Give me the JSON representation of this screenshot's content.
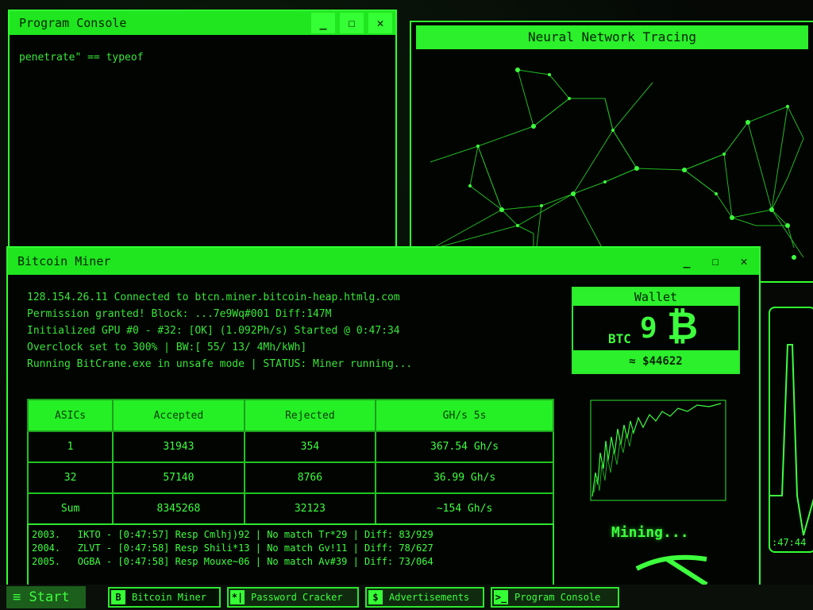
{
  "program_console": {
    "title": "Program Console",
    "text": "penetrate\" == typeof",
    "min": "_",
    "max": "☐",
    "close": "✕"
  },
  "neural": {
    "title": "Neural Network Tracing"
  },
  "miner": {
    "title": "Bitcoin Miner",
    "min": "_",
    "max": "☐",
    "close": "✕",
    "lines": [
      "128.154.26.11 Connected to btcn.miner.bitcoin-heap.htmlg.com",
      "Permission granted! Block: ...7e9Wq#001 Diff:147M",
      "Initialized GPU #0 - #32: [OK] (1.092Ph/s) Started @ 0:47:34",
      "Overclock set to 300% | BW:[ 55/ 13/ 4Mh/kWh]",
      "Running BitCrane.exe in unsafe mode | STATUS: Miner running..."
    ],
    "table": {
      "headers": [
        "ASICs",
        "Accepted",
        "Rejected",
        "GH/s 5s"
      ],
      "rows": [
        [
          "1",
          "31943",
          "354",
          "367.54 Gh/s"
        ],
        [
          "32",
          "57140",
          "8766",
          "36.99 Gh/s"
        ],
        [
          "Sum",
          "8345268",
          "32123",
          "~154 Gh/s"
        ]
      ]
    },
    "log": [
      "2003.   IKTO - [0:47:57] Resp Cmlhj)92 | No match Tr*29 | Diff: 83/929",
      "2004.   ZLVT - [0:47:58] Resp Shili*13 | No match Gv!11 | Diff: 78/627",
      "2005.   OGBA - [0:47:58] Resp Mouxe~06 | No match Av#39 | Diff: 73/064"
    ],
    "wallet": {
      "title": "Wallet",
      "currency": "BTC",
      "amount": "9",
      "btc_symbol": "₿",
      "usd": "≈ $44622"
    },
    "mining_status": "Mining...",
    "monitor_time": ":47:44"
  },
  "taskbar": {
    "start": "≡ Start",
    "items": [
      {
        "icon": "B",
        "label": "Bitcoin Miner"
      },
      {
        "icon": "*|",
        "label": "Password Cracker"
      },
      {
        "icon": "$",
        "label": "Advertisements"
      },
      {
        "icon": ">_",
        "label": "Program Console"
      }
    ]
  },
  "colors": {
    "accent": "#31ff31",
    "background": "#050805"
  }
}
